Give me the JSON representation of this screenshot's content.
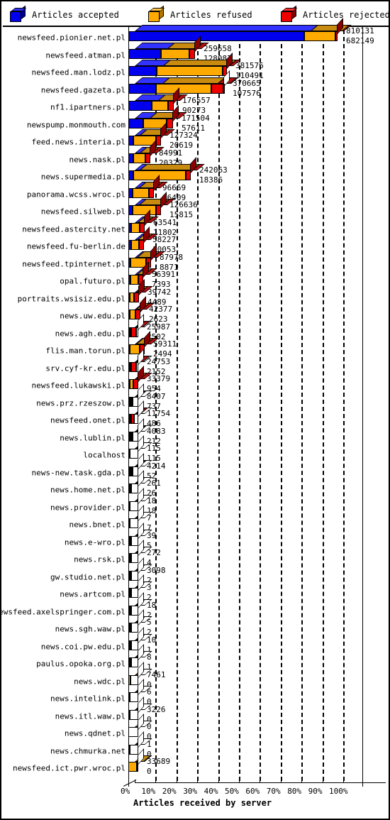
{
  "legend": {
    "items": [
      {
        "label": "Articles accepted",
        "color": "#0000EE",
        "side": "#00008B",
        "top": "#3333FF",
        "name": "legend-accepted"
      },
      {
        "label": "Articles refused",
        "color": "#FFAA00",
        "side": "#B37700",
        "top": "#FFC44D",
        "name": "legend-refused"
      },
      {
        "label": "Articles rejected",
        "color": "#EE0000",
        "side": "#8B0000",
        "top": "#FF3333",
        "name": "legend-rejected"
      }
    ]
  },
  "axis": {
    "x_title": "Articles received by server",
    "x_ticks": [
      "0%",
      "10%",
      "20%",
      "30%",
      "40%",
      "50%",
      "60%",
      "70%",
      "80%",
      "90%",
      "100%"
    ]
  },
  "chart_data": {
    "type": "bar",
    "title": "",
    "subtitle": "",
    "orientation": "horizontal",
    "stacked": true,
    "xlabel": "Articles received by server",
    "ylabel": "",
    "xlim": [
      0,
      100
    ],
    "x_unit": "percent",
    "grid": true,
    "legend_position": "top",
    "series": [
      {
        "name": "Articles accepted",
        "color": "#0000EE"
      },
      {
        "name": "Articles refused",
        "color": "#FFAA00"
      },
      {
        "name": "Articles rejected",
        "color": "#EE0000"
      }
    ],
    "value_label_note": "Top number = articles received (total bar length); bottom number = articles accepted",
    "categories": [
      "newsfeed.pionier.net.pl",
      "newsfeed.atman.pl",
      "newsfeed.man.lodz.pl",
      "newsfeed.gazeta.pl",
      "nf1.ipartners.pl",
      "newspump.monmouth.com",
      "feed.news.interia.pl",
      "news.nask.pl",
      "news.supermedia.pl",
      "panorama.wcss.wroc.pl",
      "newsfeed.silweb.pl",
      "newsfeed.astercity.net",
      "newsfeed.fu-berlin.de",
      "newsfeed.tpinternet.pl",
      "opal.futuro.pl",
      "portraits.wsisiz.edu.pl",
      "news.uw.edu.pl",
      "news.agh.edu.pl",
      "flis.man.torun.pl",
      "srv.cyf-kr.edu.pl",
      "newsfeed.lukawski.pl",
      "news.prz.rzeszow.pl",
      "newsfeed.onet.pl",
      "news.lublin.pl",
      "localhost",
      "news-new.task.gda.pl",
      "news.home.net.pl",
      "news.provider.pl",
      "news.bnet.pl",
      "news.e-wro.pl",
      "news.rsk.pl",
      "gw.studio.net.pl",
      "news.artcom.pl",
      "newsfeed.axelspringer.com.pl",
      "news.sgh.waw.pl",
      "news.coi.pw.edu.pl",
      "paulus.opoka.org.pl",
      "news.wdc.pl",
      "news.intelink.pl",
      "news.itl.waw.pl",
      "news.qdnet.pl",
      "news.chmurka.net",
      "newsfeed.ict.pwr.wroc.pl"
    ],
    "rows": [
      {
        "server": "newsfeed.pionier.net.pl",
        "received": 810131,
        "accepted": 682149,
        "refused": 120000,
        "rejected": 7982
      },
      {
        "server": "newsfeed.atman.pl",
        "received": 259658,
        "accepted": 128087,
        "refused": 110000,
        "rejected": 21571
      },
      {
        "server": "newsfeed.man.lodz.pl",
        "received": 381576,
        "accepted": 110491,
        "refused": 255000,
        "rejected": 16085
      },
      {
        "server": "newsfeed.gazeta.pl",
        "received": 370665,
        "accepted": 107576,
        "refused": 215000,
        "rejected": 48089
      },
      {
        "server": "nf1.ipartners.pl",
        "received": 176557,
        "accepted": 90273,
        "refused": 64000,
        "rejected": 22284
      },
      {
        "server": "newspump.monmouth.com",
        "received": 171504,
        "accepted": 57611,
        "refused": 90000,
        "rejected": 23893
      },
      {
        "server": "feed.news.interia.pl",
        "received": 127324,
        "accepted": 20619,
        "refused": 88000,
        "rejected": 18705
      },
      {
        "server": "news.nask.pl",
        "received": 84991,
        "accepted": 20329,
        "refused": 46000,
        "rejected": 18662
      },
      {
        "server": "news.supermedia.pl",
        "received": 242063,
        "accepted": 18386,
        "refused": 205000,
        "rejected": 18677
      },
      {
        "server": "panorama.wcss.wroc.pl",
        "received": 96669,
        "accepted": 16409,
        "refused": 62000,
        "rejected": 18260
      },
      {
        "server": "newsfeed.silweb.pl",
        "received": 126636,
        "accepted": 15815,
        "refused": 92000,
        "rejected": 18821
      },
      {
        "server": "newsfeed.astercity.net",
        "received": 63541,
        "accepted": 11802,
        "refused": 33000,
        "rejected": 18739
      },
      {
        "server": "newsfeed.fu-berlin.de",
        "received": 58227,
        "accepted": 10053,
        "refused": 30000,
        "rejected": 18174
      },
      {
        "server": "newsfeed.tpinternet.pl",
        "received": 87978,
        "accepted": 8871,
        "refused": 60000,
        "rejected": 19107
      },
      {
        "server": "opal.futuro.pl",
        "received": 56391,
        "accepted": 7393,
        "refused": 30000,
        "rejected": 18998
      },
      {
        "server": "portraits.wsisiz.edu.pl",
        "received": 39742,
        "accepted": 4489,
        "refused": 17000,
        "rejected": 18253
      },
      {
        "server": "news.uw.edu.pl",
        "received": 42377,
        "accepted": 2623,
        "refused": 21000,
        "rejected": 18754
      },
      {
        "server": "news.agh.edu.pl",
        "received": 25987,
        "accepted": 2502,
        "refused": 5000,
        "rejected": 18485
      },
      {
        "server": "flis.man.torun.pl",
        "received": 59311,
        "accepted": 2494,
        "refused": 38000,
        "rejected": 18817
      },
      {
        "server": "srv.cyf-kr.edu.pl",
        "received": 24753,
        "accepted": 2152,
        "refused": 4000,
        "rejected": 18601
      },
      {
        "server": "newsfeed.lukawski.pl",
        "received": 33379,
        "accepted": 954,
        "refused": 13500,
        "rejected": 18925
      },
      {
        "server": "news.prz.rzeszow.pl",
        "received": 8407,
        "accepted": 737,
        "refused": 1000,
        "rejected": 6670
      },
      {
        "server": "newsfeed.onet.pl",
        "received": 11754,
        "accepted": 486,
        "refused": 1500,
        "rejected": 9768
      },
      {
        "server": "news.lublin.pl",
        "received": 4083,
        "accepted": 212,
        "refused": 200,
        "rejected": 3671
      },
      {
        "server": "localhost",
        "received": 115,
        "accepted": 115,
        "refused": 0,
        "rejected": 0
      },
      {
        "server": "news-new.task.gda.pl",
        "received": 4214,
        "accepted": 52,
        "refused": 100,
        "rejected": 4062
      },
      {
        "server": "news.home.net.pl",
        "received": 261,
        "accepted": 26,
        "refused": 235,
        "rejected": 0
      },
      {
        "server": "news.provider.pl",
        "received": 18,
        "accepted": 18,
        "refused": 0,
        "rejected": 0
      },
      {
        "server": "news.bnet.pl",
        "received": 7,
        "accepted": 7,
        "refused": 0,
        "rejected": 0
      },
      {
        "server": "news.e-wro.pl",
        "received": 39,
        "accepted": 5,
        "refused": 34,
        "rejected": 0
      },
      {
        "server": "news.rsk.pl",
        "received": 272,
        "accepted": 4,
        "refused": 0,
        "rejected": 268
      },
      {
        "server": "gw.studio.net.pl",
        "received": 3098,
        "accepted": 2,
        "refused": 3096,
        "rejected": 0
      },
      {
        "server": "news.artcom.pl",
        "received": 3,
        "accepted": 2,
        "refused": 1,
        "rejected": 0
      },
      {
        "server": "newsfeed.axelspringer.com.pl",
        "received": 18,
        "accepted": 2,
        "refused": 16,
        "rejected": 0
      },
      {
        "server": "news.sgh.waw.pl",
        "received": 5,
        "accepted": 2,
        "refused": 3,
        "rejected": 0
      },
      {
        "server": "news.coi.pw.edu.pl",
        "received": 10,
        "accepted": 1,
        "refused": 9,
        "rejected": 0
      },
      {
        "server": "paulus.opoka.org.pl",
        "received": 8,
        "accepted": 1,
        "refused": 7,
        "rejected": 0
      },
      {
        "server": "news.wdc.pl",
        "received": 7461,
        "accepted": 0,
        "refused": 7461,
        "rejected": 0
      },
      {
        "server": "news.intelink.pl",
        "received": 6,
        "accepted": 0,
        "refused": 6,
        "rejected": 0
      },
      {
        "server": "news.itl.waw.pl",
        "received": 3226,
        "accepted": 0,
        "refused": 3226,
        "rejected": 0
      },
      {
        "server": "news.qdnet.pl",
        "received": 0,
        "accepted": 0,
        "refused": 0,
        "rejected": 0
      },
      {
        "server": "news.chmurka.net",
        "received": 1,
        "accepted": 0,
        "refused": 1,
        "rejected": 0
      },
      {
        "server": "newsfeed.ict.pwr.wroc.pl",
        "received": 33689,
        "accepted": 0,
        "refused": 33689,
        "rejected": 0
      }
    ]
  }
}
